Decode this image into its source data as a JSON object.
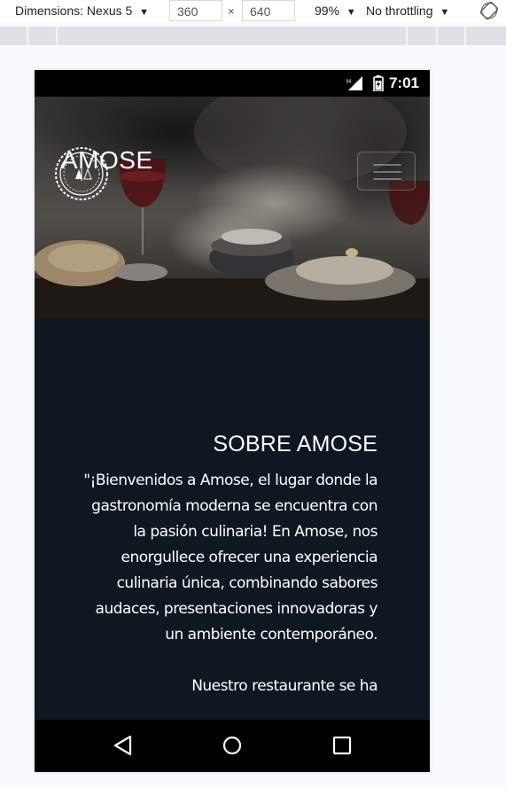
{
  "devtools": {
    "device_label": "Dimensions: Nexus 5",
    "caret": "▼",
    "width": "360",
    "times": "×",
    "height": "640",
    "zoom": "99%",
    "throttle": "No throttling",
    "rotate_icon": "rotate-icon"
  },
  "status_bar": {
    "time": "7:01",
    "icons": [
      "signal-icon",
      "battery-icon"
    ]
  },
  "header": {
    "logo_icon": "amose-logo-icon",
    "brand": "AMOSE",
    "menu_icon": "hamburger-menu-icon"
  },
  "about": {
    "title": "SOBRE AMOSE",
    "paragraph_1": "\"¡Bienvenidos a Amose, el lugar donde la gastronomía moderna se encuentra con la pasión culinaria! En Amose, nos enorgullece ofrecer una experiencia culinaria única, combinando sabores audaces, presentaciones innovadoras y un ambiente contemporáneo.",
    "paragraph_2": "Nuestro restaurante se ha"
  },
  "nav_bar": {
    "icons": [
      "back-icon",
      "home-icon",
      "recents-icon"
    ]
  },
  "colors": {
    "about_background": "#0f1721",
    "text": "#ffffff",
    "page_background": "#f8fafb"
  }
}
